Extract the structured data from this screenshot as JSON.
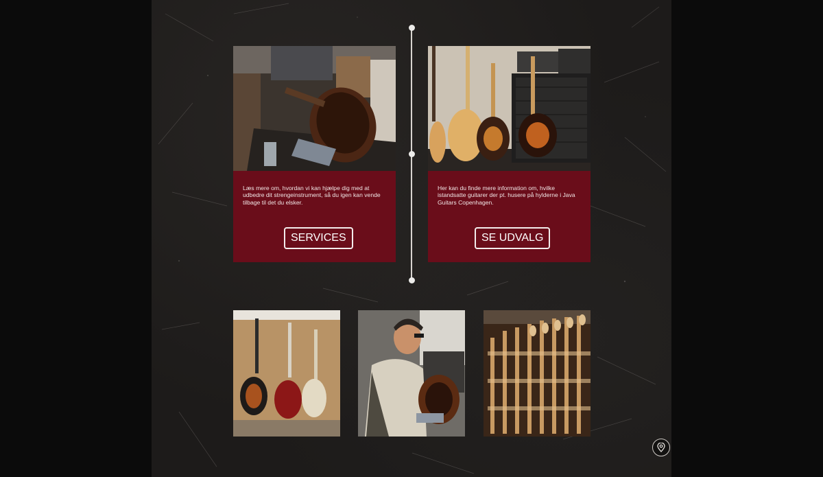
{
  "cards": [
    {
      "image": "guitar-workshop-bench-image",
      "text": "Læs mere om, hvordan vi kan hjælpe dig med at udbedre dit strengeinstrument, så du igen kan vende tilbage til det du elsker.",
      "button_label": "SERVICES"
    },
    {
      "image": "guitars-and-amplifiers-image",
      "text": "Her kan du finde mere information om, hvilke istandsatte guitarer der pt. husere på hylderne i Java Guitars Copenhagen.",
      "button_label": "SE UDVALG"
    }
  ],
  "gallery": [
    {
      "image": "guitars-on-wall-image"
    },
    {
      "image": "luthier-repairing-guitar-image"
    },
    {
      "image": "tool-wall-image"
    }
  ],
  "map_button": {
    "icon": "location-pin-icon"
  },
  "colors": {
    "card_background": "#6a0d1a",
    "page_background": "#1d1b1a",
    "side_background": "#0b0b0b",
    "accent_light": "#f3ecec"
  }
}
